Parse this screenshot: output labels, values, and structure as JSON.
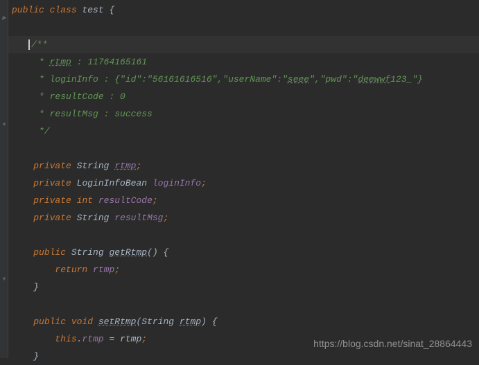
{
  "code": {
    "line1": {
      "kw1": "public",
      "kw2": "class",
      "classname": "test",
      "brace": "{"
    },
    "doc": {
      "open": "/**",
      "l1_star": " * ",
      "l1_rtmp": "rtmp",
      "l1_rest": " : 11764165161",
      "l2_pre": " * loginInfo : {\"id\":\"56161616516\",\"userName\":\"",
      "l2_seee": "seee",
      "l2_mid": "\",\"pwd\":\"",
      "l2_deewwf": "deewwf",
      "l2_end": "123_\"}",
      "l3": " * resultCode : 0",
      "l4": " * resultMsg : success",
      "close": " */"
    },
    "f1": {
      "kw": "private",
      "type": "String",
      "name": "rtmp",
      "semi": ";"
    },
    "f2": {
      "kw": "private",
      "type": "LoginInfoBean",
      "name": "loginInfo",
      "semi": ";"
    },
    "f3": {
      "kw": "private",
      "type": "int",
      "name": "resultCode",
      "semi": ";"
    },
    "f4": {
      "kw": "private",
      "type": "String",
      "name": "resultMsg",
      "semi": ";"
    },
    "m1": {
      "kw": "public",
      "type": "String",
      "name": "getRtmp",
      "params": "()",
      "brace": "{"
    },
    "m1_body": {
      "kw": "return",
      "field": "rtmp",
      "semi": ";"
    },
    "m1_close": "}",
    "m2": {
      "kw": "public",
      "type": "void",
      "name": "setRtmp",
      "p_open": "(",
      "p_type": "String",
      "p_name": "rtmp",
      "p_close": ")",
      "brace": "{"
    },
    "m2_body": {
      "kw": "this",
      "dot": ".",
      "field": "rtmp",
      "eq": " = ",
      "param": "rtmp",
      "semi": ";"
    },
    "m2_close": "}"
  },
  "watermark": "https://blog.csdn.net/sinat_28864443"
}
